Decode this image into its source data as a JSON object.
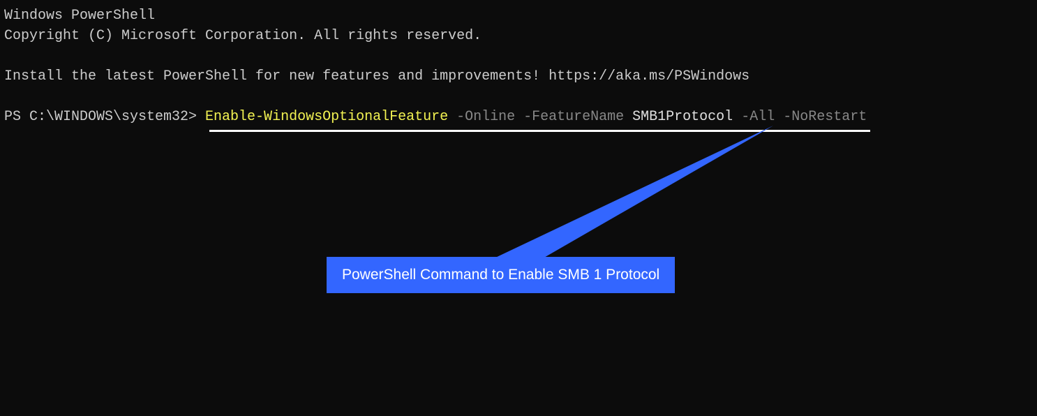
{
  "header": {
    "line1": "Windows PowerShell",
    "line2": "Copyright (C) Microsoft Corporation. All rights reserved.",
    "line3": "Install the latest PowerShell for new features and improvements! https://aka.ms/PSWindows"
  },
  "prompt": {
    "path": "PS C:\\WINDOWS\\system32> ",
    "cmdlet": "Enable-WindowsOptionalFeature",
    "param1": " -Online",
    "param2": " -FeatureName",
    "value1": " SMB1Protocol",
    "param3": " -All",
    "param4": " -NoRestart"
  },
  "annotation": {
    "label": "PowerShell Command to Enable SMB 1 Protocol"
  }
}
